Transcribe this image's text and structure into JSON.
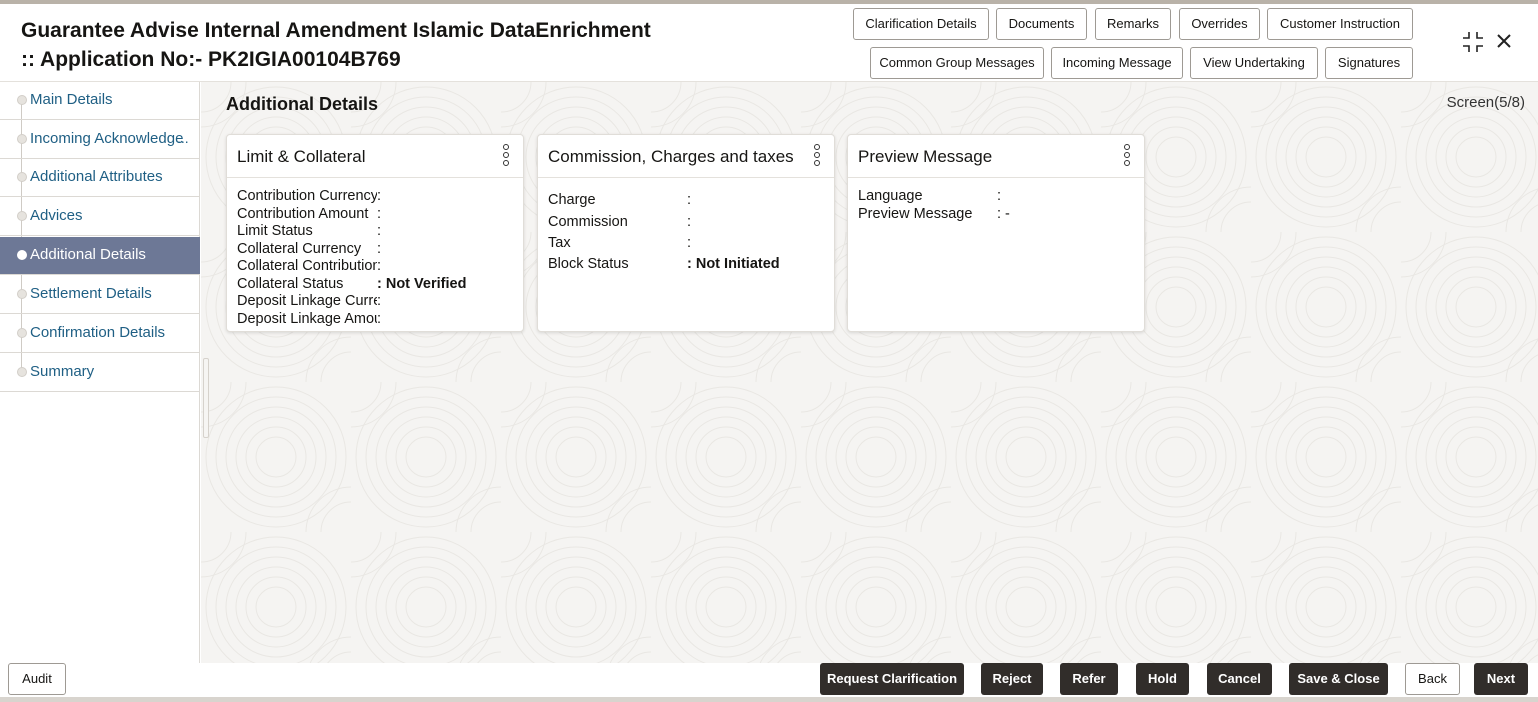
{
  "header": {
    "title_line1": "Guarantee Advise Internal Amendment Islamic DataEnrichment",
    "title_line2": ":: Application No:- PK2IGIA00104B769",
    "buttons_row1": [
      "Clarification Details",
      "Documents",
      "Remarks",
      "Overrides",
      "Customer Instruction"
    ],
    "buttons_row2": [
      "Common Group Messages",
      "Incoming Message",
      "View Undertaking",
      "Signatures"
    ],
    "minimize_icon": "collapse-icon",
    "close_icon": "close-icon"
  },
  "sidebar": {
    "items": [
      {
        "label": "Main Details",
        "active": false
      },
      {
        "label": "Incoming Acknowledge",
        "active": false
      },
      {
        "label": "Additional Attributes",
        "active": false
      },
      {
        "label": "Advices",
        "active": false
      },
      {
        "label": "Additional Details",
        "active": true
      },
      {
        "label": "Settlement Details",
        "active": false
      },
      {
        "label": "Confirmation Details",
        "active": false
      },
      {
        "label": "Summary",
        "active": false
      }
    ],
    "overflow_marker": "..."
  },
  "main": {
    "section_title": "Additional Details",
    "screen_indicator": "Screen(5/8)",
    "cards": [
      {
        "title": "Limit & Collateral",
        "rows": [
          {
            "label": "Contribution Currency",
            "value": ":"
          },
          {
            "label": "Contribution Amount",
            "value": ":"
          },
          {
            "label": "Limit Status",
            "value": ":"
          },
          {
            "label": "Collateral Currency",
            "value": ":"
          },
          {
            "label": "Collateral Contribution",
            "value": ":"
          },
          {
            "label": "Collateral Status",
            "value": ": Not Verified"
          },
          {
            "label": "Deposit Linkage Currency",
            "value": ":"
          },
          {
            "label": "Deposit Linkage Amount",
            "value": ":"
          }
        ]
      },
      {
        "title": "Commission, Charges and taxes",
        "rows": [
          {
            "label": "Charge",
            "value": ":"
          },
          {
            "label": "Commission",
            "value": ":"
          },
          {
            "label": "Tax",
            "value": ":"
          },
          {
            "label": "Block Status",
            "value": ": Not Initiated"
          }
        ]
      },
      {
        "title": "Preview Message",
        "rows": [
          {
            "label": "Language",
            "value": ":"
          },
          {
            "label": "Preview Message",
            "value": ": -"
          }
        ]
      }
    ]
  },
  "footer": {
    "audit_label": "Audit",
    "actions": [
      "Request Clarification",
      "Reject",
      "Refer",
      "Hold",
      "Cancel",
      "Save & Close",
      "Back",
      "Next"
    ]
  }
}
